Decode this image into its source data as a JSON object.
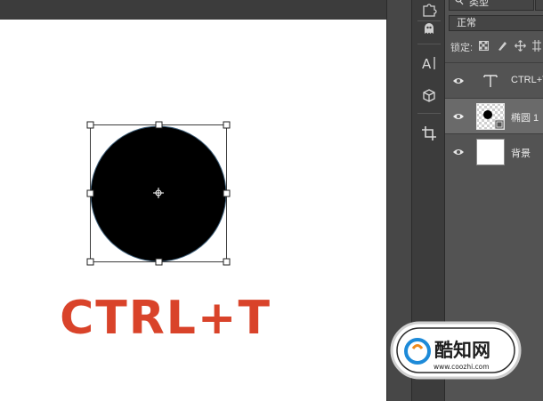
{
  "blend_mode": {
    "value": "正常"
  },
  "kind_filter": {
    "label": "类型"
  },
  "lock": {
    "label": "锁定:"
  },
  "layers": [
    {
      "name": "CTRL+T",
      "type": "text",
      "selected": false
    },
    {
      "name": "椭圆 1",
      "type": "shape",
      "selected": true
    },
    {
      "name": "背景",
      "type": "background",
      "selected": false
    }
  ],
  "canvas": {
    "text": "CTRL+T",
    "text_color": "#d9432a",
    "shape_color": "#000000"
  },
  "tools": [
    "puzzle-icon",
    "ghost-icon",
    "character-icon",
    "cube-icon",
    "crop-icon"
  ],
  "watermark": {
    "brand": "酷知网",
    "url": "www.coozhi.com"
  },
  "colors": {
    "panel_bg": "#535353",
    "toolbar_bg": "#3c3c3c",
    "selected_layer": "#6a6a6a",
    "accent_blue": "#1d8ad8"
  }
}
